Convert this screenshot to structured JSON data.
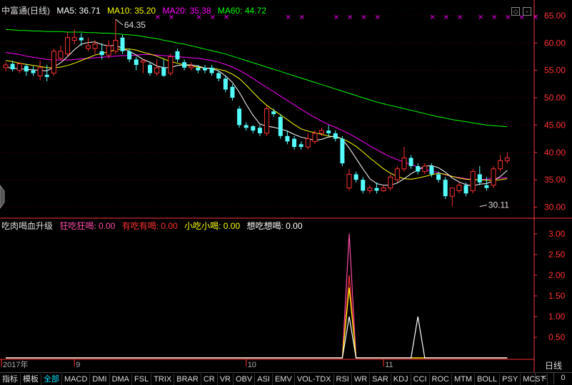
{
  "header_main": {
    "name": "中富通(日线)",
    "ma5": "MA5: 36.71",
    "ma10": "MA10: 35.20",
    "ma20": "MA20: 35.38",
    "ma60": "MA60: 44.72"
  },
  "header_ind": {
    "name": "吃肉喝血升级",
    "s1": "狂吃狂喝: 0.00",
    "s2": "有吃有喝: 0.00",
    "s3": "小吃小喝: 0.00",
    "s4": "想吃想喝: 0.00"
  },
  "colors": {
    "up": "#ff3232",
    "down": "#54fcfc",
    "ma5": "#ffffff",
    "ma10": "#ffff00",
    "ma20": "#ff00ff",
    "ma60": "#00ff00",
    "axis": "#ff3232",
    "grid": "#8b0000"
  },
  "tabs": [
    "指标",
    "模板",
    "全部",
    "MACD",
    "DMI",
    "DMA",
    "FSL",
    "TRIX",
    "BRAR",
    "CR",
    "VR",
    "OBV",
    "ASI",
    "EMV",
    "VOL-TDX",
    "RSI",
    "WR",
    "SAR",
    "KDJ",
    "CCI",
    "ROC",
    "MTM",
    "BOLL",
    "PSY",
    "MCST"
  ],
  "selected_tab": "全部",
  "period_label": "日线",
  "nav": [
    "<",
    "0"
  ],
  "chart_data": [
    {
      "type": "candlestick",
      "title": "中富通(日线)",
      "ylim": [
        29,
        66
      ],
      "y_ticks": [
        "65.00",
        "60.00",
        "55.00",
        "50.00",
        "45.00",
        "40.00",
        "35.00",
        "30.00"
      ],
      "x_labels": [
        {
          "label": "2017年",
          "index": 0
        },
        {
          "label": "9",
          "index": 10
        },
        {
          "label": "10",
          "index": 35
        },
        {
          "label": "11",
          "index": 55
        }
      ],
      "annotations": [
        {
          "text": "64.35",
          "index": 16,
          "value": 64.35
        },
        {
          "text": "30.11",
          "index": 69,
          "value": 30.11
        }
      ],
      "marker_indices": [
        22,
        24,
        28,
        30,
        32,
        41,
        43,
        48,
        50,
        52,
        54,
        62,
        64,
        66,
        69,
        71,
        73,
        75,
        77
      ],
      "candles": [
        {
          "o": 55.5,
          "h": 56.5,
          "c": 56.0,
          "l": 54.8
        },
        {
          "o": 56.2,
          "h": 56.8,
          "c": 55.2,
          "l": 54.8
        },
        {
          "o": 55.0,
          "h": 56.5,
          "c": 56.2,
          "l": 54.5
        },
        {
          "o": 55.8,
          "h": 56.2,
          "c": 54.8,
          "l": 54.0
        },
        {
          "o": 55.0,
          "h": 55.8,
          "c": 54.5,
          "l": 54.0
        },
        {
          "o": 54.0,
          "h": 56.8,
          "c": 55.5,
          "l": 53.2
        },
        {
          "o": 54.2,
          "h": 56.0,
          "c": 53.8,
          "l": 53.0
        },
        {
          "o": 54.5,
          "h": 59.0,
          "c": 58.5,
          "l": 54.0
        },
        {
          "o": 57.2,
          "h": 59.5,
          "c": 58.5,
          "l": 56.8
        },
        {
          "o": 58.0,
          "h": 62.0,
          "c": 61.0,
          "l": 57.5
        },
        {
          "o": 60.5,
          "h": 62.5,
          "c": 61.0,
          "l": 59.8
        },
        {
          "o": 61.0,
          "h": 61.8,
          "c": 60.5,
          "l": 59.5
        },
        {
          "o": 59.0,
          "h": 61.0,
          "c": 59.5,
          "l": 58.5
        },
        {
          "o": 59.0,
          "h": 60.5,
          "c": 59.8,
          "l": 58.0
        },
        {
          "o": 58.5,
          "h": 60.0,
          "c": 57.8,
          "l": 57.0
        },
        {
          "o": 57.8,
          "h": 60.5,
          "c": 59.5,
          "l": 57.2
        },
        {
          "o": 58.5,
          "h": 64.35,
          "c": 60.5,
          "l": 58.0
        },
        {
          "o": 61.0,
          "h": 61.5,
          "c": 58.5,
          "l": 58.0
        },
        {
          "o": 58.5,
          "h": 59.0,
          "c": 57.0,
          "l": 56.5
        },
        {
          "o": 57.0,
          "h": 57.5,
          "c": 56.0,
          "l": 55.0
        },
        {
          "o": 56.5,
          "h": 57.0,
          "c": 56.8,
          "l": 54.5
        },
        {
          "o": 56.0,
          "h": 56.5,
          "c": 54.5,
          "l": 54.0
        },
        {
          "o": 54.5,
          "h": 57.0,
          "c": 55.5,
          "l": 54.0
        },
        {
          "o": 55.5,
          "h": 57.0,
          "c": 54.0,
          "l": 53.8
        },
        {
          "o": 54.5,
          "h": 58.0,
          "c": 57.5,
          "l": 54.0
        },
        {
          "o": 58.5,
          "h": 59.0,
          "c": 57.0,
          "l": 56.5
        },
        {
          "o": 56.5,
          "h": 57.0,
          "c": 55.5,
          "l": 55.0
        },
        {
          "o": 55.5,
          "h": 56.5,
          "c": 55.8,
          "l": 55.0
        },
        {
          "o": 55.5,
          "h": 56.0,
          "c": 55.0,
          "l": 54.5
        },
        {
          "o": 55.5,
          "h": 56.0,
          "c": 55.0,
          "l": 54.5
        },
        {
          "o": 55.5,
          "h": 56.0,
          "c": 54.5,
          "l": 54.0
        },
        {
          "o": 54.5,
          "h": 55.0,
          "c": 53.5,
          "l": 53.0
        },
        {
          "o": 53.5,
          "h": 54.0,
          "c": 51.5,
          "l": 51.0
        },
        {
          "o": 52.0,
          "h": 52.5,
          "c": 50.0,
          "l": 49.5
        },
        {
          "o": 48.0,
          "h": 48.5,
          "c": 45.0,
          "l": 44.5
        },
        {
          "o": 45.0,
          "h": 45.5,
          "c": 44.5,
          "l": 44.0
        },
        {
          "o": 44.8,
          "h": 45.0,
          "c": 44.0,
          "l": 43.5
        },
        {
          "o": 44.5,
          "h": 45.0,
          "c": 43.5,
          "l": 43.0
        },
        {
          "o": 43.5,
          "h": 48.5,
          "c": 48.0,
          "l": 43.0
        },
        {
          "o": 47.5,
          "h": 48.0,
          "c": 47.0,
          "l": 46.5
        },
        {
          "o": 46.5,
          "h": 47.0,
          "c": 43.0,
          "l": 42.5
        },
        {
          "o": 43.0,
          "h": 44.0,
          "c": 42.0,
          "l": 41.5
        },
        {
          "o": 42.5,
          "h": 43.0,
          "c": 41.0,
          "l": 40.5
        },
        {
          "o": 41.5,
          "h": 42.0,
          "c": 41.0,
          "l": 40.5
        },
        {
          "o": 41.0,
          "h": 43.5,
          "c": 42.5,
          "l": 40.5
        },
        {
          "o": 42.0,
          "h": 44.0,
          "c": 43.5,
          "l": 41.5
        },
        {
          "o": 43.5,
          "h": 44.5,
          "c": 44.0,
          "l": 43.0
        },
        {
          "o": 44.0,
          "h": 45.0,
          "c": 43.5,
          "l": 43.0
        },
        {
          "o": 43.5,
          "h": 44.0,
          "c": 42.5,
          "l": 42.0
        },
        {
          "o": 42.5,
          "h": 43.0,
          "c": 38.0,
          "l": 37.5
        },
        {
          "o": 33.5,
          "h": 37.0,
          "c": 36.0,
          "l": 33.0
        },
        {
          "o": 36.0,
          "h": 36.5,
          "c": 35.0,
          "l": 34.5
        },
        {
          "o": 35.0,
          "h": 35.5,
          "c": 33.0,
          "l": 32.5
        },
        {
          "o": 33.0,
          "h": 34.0,
          "c": 33.5,
          "l": 32.5
        },
        {
          "o": 33.5,
          "h": 34.5,
          "c": 33.0,
          "l": 32.5
        },
        {
          "o": 33.0,
          "h": 34.0,
          "c": 33.5,
          "l": 32.8
        },
        {
          "o": 33.5,
          "h": 36.0,
          "c": 35.5,
          "l": 33.0
        },
        {
          "o": 35.0,
          "h": 37.5,
          "c": 37.0,
          "l": 34.5
        },
        {
          "o": 37.0,
          "h": 41.0,
          "c": 39.0,
          "l": 36.5
        },
        {
          "o": 39.0,
          "h": 39.5,
          "c": 37.5,
          "l": 37.0
        },
        {
          "o": 37.5,
          "h": 38.0,
          "c": 36.5,
          "l": 36.0
        },
        {
          "o": 36.5,
          "h": 38.0,
          "c": 37.5,
          "l": 36.0
        },
        {
          "o": 37.5,
          "h": 38.0,
          "c": 36.0,
          "l": 35.5
        },
        {
          "o": 36.0,
          "h": 36.5,
          "c": 35.0,
          "l": 34.5
        },
        {
          "o": 35.0,
          "h": 35.5,
          "c": 32.0,
          "l": 31.5
        },
        {
          "o": 32.0,
          "h": 33.5,
          "c": 33.5,
          "l": 30.11
        },
        {
          "o": 33.0,
          "h": 34.5,
          "c": 34.0,
          "l": 32.5
        },
        {
          "o": 34.0,
          "h": 34.5,
          "c": 32.5,
          "l": 32.0
        },
        {
          "o": 33.0,
          "h": 37.0,
          "c": 36.5,
          "l": 32.5
        },
        {
          "o": 36.0,
          "h": 37.5,
          "c": 34.5,
          "l": 34.0
        },
        {
          "o": 34.0,
          "h": 35.5,
          "c": 33.5,
          "l": 33.0
        },
        {
          "o": 34.0,
          "h": 37.5,
          "c": 37.0,
          "l": 33.5
        },
        {
          "o": 37.0,
          "h": 39.5,
          "c": 38.5,
          "l": 36.5
        },
        {
          "o": 38.5,
          "h": 40.0,
          "c": 39.0,
          "l": 38.0
        }
      ],
      "ma5": [
        55.6,
        55.4,
        55.3,
        55.2,
        55.1,
        55.0,
        54.9,
        55.6,
        56.4,
        57.5,
        58.8,
        59.8,
        60.1,
        60.2,
        59.7,
        59.5,
        59.6,
        59.0,
        58.5,
        57.8,
        57.0,
        56.5,
        55.8,
        55.5,
        55.5,
        55.9,
        56.0,
        56.0,
        55.8,
        55.4,
        55.3,
        54.9,
        54.0,
        52.8,
        51.0,
        48.8,
        46.8,
        45.2,
        44.8,
        44.6,
        44.3,
        43.9,
        43.3,
        42.8,
        42.5,
        42.2,
        42.4,
        42.8,
        43.0,
        42.4,
        40.8,
        38.9,
        37.0,
        35.2,
        34.3,
        34.0,
        34.0,
        34.4,
        35.2,
        36.1,
        36.8,
        37.5,
        37.6,
        37.2,
        36.4,
        35.3,
        34.6,
        34.1,
        33.9,
        34.2,
        34.3,
        34.8,
        35.6,
        36.7
      ],
      "ma10": [
        56.8,
        56.6,
        56.3,
        56.1,
        55.9,
        55.7,
        55.5,
        55.5,
        55.6,
        55.9,
        56.3,
        56.8,
        57.3,
        57.8,
        58.1,
        58.4,
        58.8,
        58.9,
        58.9,
        58.7,
        58.3,
        58.0,
        57.6,
        57.1,
        56.6,
        56.3,
        56.0,
        55.8,
        55.6,
        55.4,
        55.4,
        55.2,
        54.9,
        54.3,
        53.5,
        52.3,
        51.0,
        49.7,
        48.6,
        47.7,
        46.9,
        46.0,
        45.1,
        44.3,
        43.9,
        43.6,
        43.3,
        43.0,
        42.8,
        42.5,
        41.9,
        41.1,
        40.1,
        39.0,
        38.0,
        37.0,
        36.2,
        35.6,
        35.2,
        35.1,
        35.3,
        35.6,
        35.9,
        36.2,
        36.0,
        35.6,
        35.3,
        35.1,
        35.0,
        35.0,
        34.9,
        34.9,
        35.0,
        35.2
      ],
      "ma20": [
        58.3,
        58.1,
        57.9,
        57.6,
        57.4,
        57.2,
        57.0,
        56.9,
        56.9,
        56.9,
        57.0,
        57.1,
        57.2,
        57.3,
        57.4,
        57.5,
        57.6,
        57.7,
        57.7,
        57.8,
        57.9,
        57.9,
        57.8,
        57.7,
        57.6,
        57.5,
        57.4,
        57.3,
        57.2,
        57.0,
        56.8,
        56.5,
        56.1,
        55.6,
        55.0,
        54.3,
        53.5,
        52.7,
        51.9,
        51.1,
        50.3,
        49.5,
        48.7,
        47.9,
        47.1,
        46.4,
        45.7,
        45.1,
        44.6,
        44.0,
        43.4,
        42.7,
        42.0,
        41.2,
        40.5,
        39.8,
        39.2,
        38.7,
        38.2,
        37.8,
        37.3,
        36.9,
        36.6,
        36.3,
        35.9,
        35.6,
        35.4,
        35.2,
        35.0,
        35.0,
        35.1,
        35.2,
        35.3,
        35.4
      ],
      "ma60": [
        62.5,
        62.4,
        62.3,
        62.3,
        62.2,
        62.2,
        62.1,
        62.1,
        62.1,
        62.0,
        62.0,
        62.0,
        61.9,
        61.9,
        61.8,
        61.8,
        61.7,
        61.6,
        61.5,
        61.4,
        61.2,
        61.0,
        60.8,
        60.5,
        60.3,
        60.0,
        59.8,
        59.5,
        59.2,
        58.9,
        58.6,
        58.3,
        58.0,
        57.6,
        57.2,
        56.8,
        56.4,
        56.0,
        55.6,
        55.2,
        54.8,
        54.4,
        54.0,
        53.6,
        53.2,
        52.8,
        52.4,
        52.0,
        51.6,
        51.2,
        50.8,
        50.4,
        50.0,
        49.6,
        49.2,
        48.9,
        48.6,
        48.3,
        48.0,
        47.7,
        47.4,
        47.1,
        46.8,
        46.5,
        46.3,
        46.0,
        45.8,
        45.6,
        45.4,
        45.2,
        45.0,
        44.9,
        44.8,
        44.72
      ]
    },
    {
      "type": "line",
      "title": "吃肉喝血升级",
      "ylim": [
        0,
        3.3
      ],
      "y_ticks": [
        "3.00",
        "2.50",
        "2.00",
        "1.50",
        "1.00",
        "0.50"
      ],
      "series": [
        {
          "name": "狂吃狂喝",
          "color": "#ff4da6",
          "points": [
            [
              0,
              0
            ],
            [
              49,
              0
            ],
            [
              50,
              3.0
            ],
            [
              51,
              0
            ],
            [
              73,
              0
            ]
          ]
        },
        {
          "name": "有吃有喝",
          "color": "#ff3232",
          "points": [
            [
              0,
              0
            ],
            [
              49,
              0
            ],
            [
              50,
              2.0
            ],
            [
              51,
              0
            ],
            [
              73,
              0
            ]
          ]
        },
        {
          "name": "小吃小喝",
          "color": "#ffff00",
          "points": [
            [
              0,
              0
            ],
            [
              49,
              0
            ],
            [
              50,
              1.7
            ],
            [
              51,
              0
            ],
            [
              73,
              0
            ]
          ]
        },
        {
          "name": "想吃想喝",
          "color": "#ffffff",
          "points": [
            [
              0,
              0
            ],
            [
              49,
              0
            ],
            [
              50,
              1.0
            ],
            [
              51,
              0
            ],
            [
              59,
              0
            ],
            [
              60,
              1.0
            ],
            [
              61,
              0
            ],
            [
              73,
              0
            ]
          ]
        }
      ]
    }
  ]
}
